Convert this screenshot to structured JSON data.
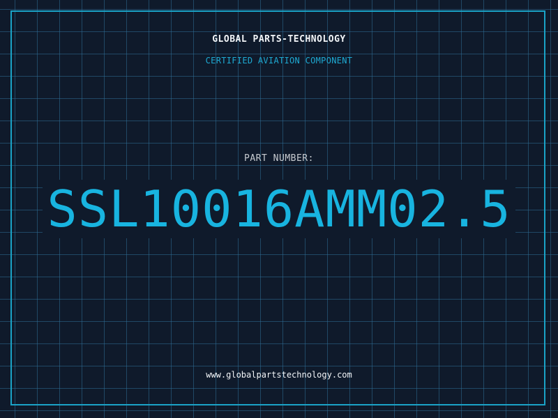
{
  "header": {
    "company": "GLOBAL PARTS-TECHNOLOGY",
    "subtitle": "CERTIFIED AVIATION COMPONENT"
  },
  "main": {
    "part_label": "PART NUMBER:",
    "part_number": "SSL10016AMM02.5"
  },
  "footer": {
    "website": "www.globalpartstechnology.com"
  },
  "colors": {
    "background": "#0f1a2b",
    "grid": "#2e6e96",
    "accent": "#18b4e0",
    "text": "#f2f5f8"
  }
}
